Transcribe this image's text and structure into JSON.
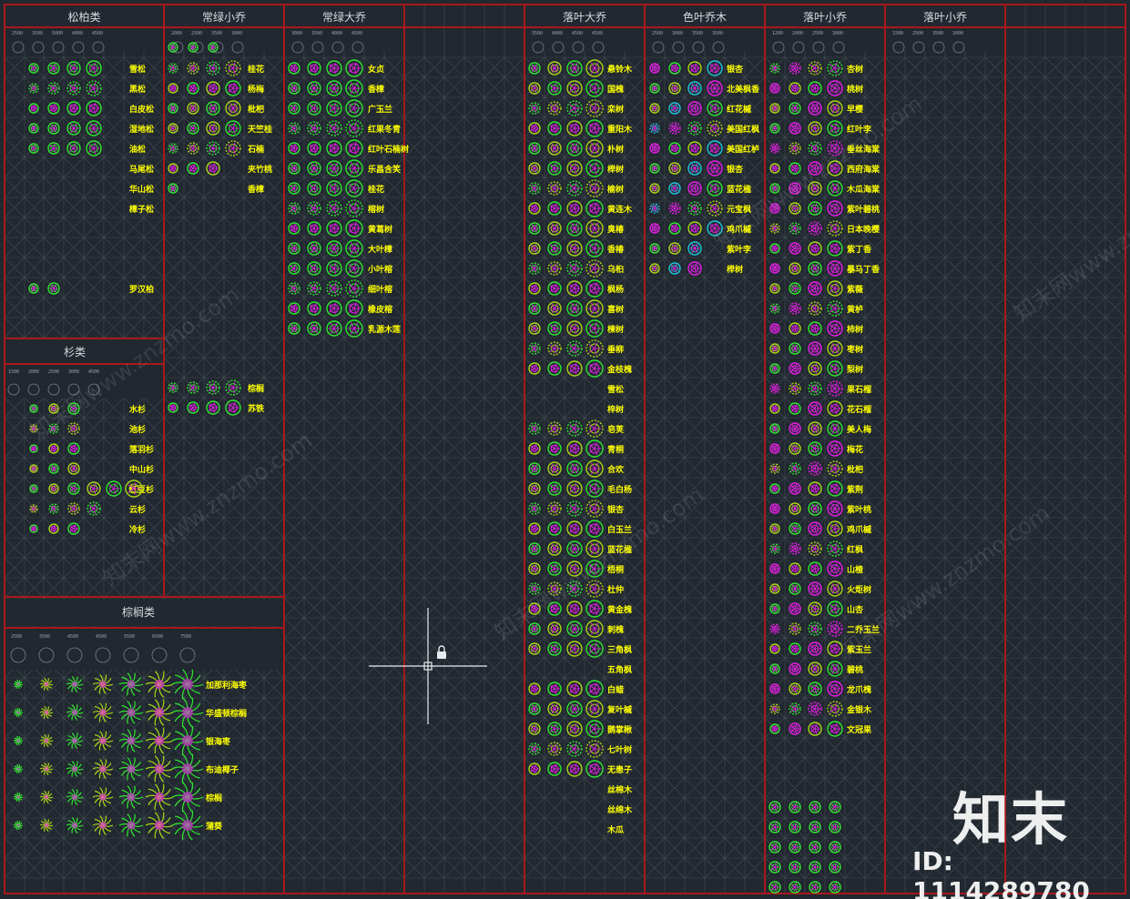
{
  "headers": {
    "pine": "松柏类",
    "evergreen_small": "常绿小乔",
    "evergreen_big": "常绿大乔",
    "deciduous_big": "落叶大乔",
    "color_leaf": "色叶乔木",
    "deciduous_small_1": "落叶小乔",
    "deciduous_small_2": "落叶小乔",
    "fir": "杉类",
    "palm": "棕榈类"
  },
  "size_labels": {
    "pine": [
      "2500",
      "3500",
      "5000",
      "4000",
      "4500"
    ],
    "evergreen_small": [
      "2000",
      "2500",
      "3500",
      "3000"
    ],
    "evergreen_big": [
      "3000",
      "3500",
      "4000",
      "4500"
    ],
    "deciduous_big": [
      "3500",
      "4000",
      "4500",
      "4500"
    ],
    "color_leaf": [
      "2500",
      "3000",
      "3500",
      "3500"
    ],
    "deciduous_small_1": [
      "1200",
      "2000",
      "2500",
      "3000"
    ],
    "deciduous_small_2": [
      "1500",
      "2500",
      "3500",
      "3000"
    ],
    "fir": [
      "1500",
      "2000",
      "2500",
      "3000",
      "4500"
    ],
    "palm": [
      "2500",
      "3500",
      "4500",
      "4500",
      "5500",
      "6500",
      "7500"
    ]
  },
  "lists": {
    "pine": [
      "雪松",
      "黑松",
      "白皮松",
      "湿地松",
      "油松",
      "马尾松",
      "华山松",
      "樟子松",
      "",
      "",
      "",
      "罗汉柏"
    ],
    "evergreen_small": [
      "桂花",
      "杨梅",
      "枇杷",
      "天竺桂",
      "石楠",
      "夹竹桃",
      "香樟"
    ],
    "evergreen_small_lower": [
      "棕榈",
      "苏铁"
    ],
    "evergreen_big": [
      "女贞",
      "香樟",
      "广玉兰",
      "红果冬青",
      "红叶石楠树",
      "乐昌含笑",
      "桂花",
      "榕树",
      "黄葛树",
      "大叶樟",
      "小叶榕",
      "细叶榕",
      "橡皮榕",
      "乳源木莲"
    ],
    "fir": [
      "水杉",
      "池杉",
      "落羽杉",
      "中山杉",
      "红豆杉",
      "云杉",
      "冷杉"
    ],
    "deciduous_big": [
      "悬铃木",
      "国槐",
      "栾树",
      "重阳木",
      "朴树",
      "榉树",
      "榆树",
      "黄连木",
      "臭椿",
      "香椿",
      "乌桕",
      "枫杨",
      "喜树",
      "楝树",
      "垂柳",
      "金枝槐",
      "雪松",
      "梓树",
      "皂荚",
      "青桐",
      "合欢",
      "毛白杨",
      "银杏",
      "白玉兰",
      "蓝花楹",
      "梧桐",
      "杜仲",
      "黄金槐",
      "刺槐",
      "三角枫",
      "五角枫",
      "白蜡",
      "复叶槭",
      "鹅掌楸",
      "七叶树",
      "无患子",
      "丝棉木",
      "丝绵木",
      "木瓜"
    ],
    "color_leaf": [
      "银杏",
      "北美枫香",
      "红花槭",
      "美国红枫",
      "美国红栌",
      "银杏",
      "蓝花楹",
      "元宝枫",
      "鸡爪槭",
      "紫叶李",
      "榉树"
    ],
    "deciduous_small_1": [
      "杏树",
      "桃树",
      "早樱",
      "红叶李",
      "垂丝海棠",
      "西府海棠",
      "木瓜海棠",
      "紫叶碧桃",
      "日本晚樱",
      "紫丁香",
      "暴马丁香",
      "紫薇",
      "黄栌",
      "柿树",
      "枣树",
      "梨树",
      "果石榴",
      "花石榴",
      "美人梅",
      "梅花",
      "枇杷",
      "紫荆",
      "紫叶桃",
      "鸡爪槭",
      "红枫",
      "山楂",
      "火炬树",
      "山杏",
      "二乔玉兰",
      "紫玉兰",
      "碧桃",
      "龙爪槐",
      "金银木",
      "文冠果"
    ],
    "palm": [
      "加那利海枣",
      "华盛顿棕榈",
      "银海枣",
      "布迪椰子",
      "棕榈",
      "蒲葵"
    ]
  },
  "colors": {
    "background": "#212830",
    "frame_red": "#a8181c",
    "grid": "#5e6670",
    "label_yellow": "#ffff00",
    "symbol_green": "#2ee82e",
    "symbol_magenta": "#e61ee6",
    "symbol_lime": "#a8d814",
    "symbol_cyan": "#18c8d8"
  },
  "watermark": {
    "logo": "知末",
    "id": "ID: 1114289780",
    "tiles": [
      "知末网www.znzmo.com",
      "知末网www.znzmo.com",
      "知末网www.znzmo.com",
      "知末网www.znzmo.com",
      "知末网www.znzmo.com",
      "知末网www.znzmo.com"
    ]
  },
  "cursor": {
    "icon": "crosshair-cursor-icon",
    "lock": "lock-icon"
  }
}
